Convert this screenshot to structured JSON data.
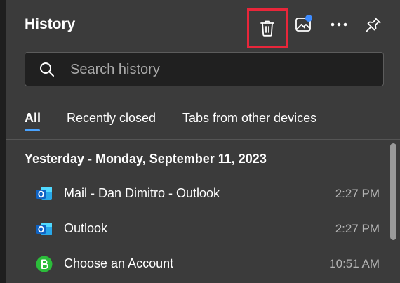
{
  "panel": {
    "title": "History",
    "buttons": {
      "delete_icon": "trash-icon",
      "open_in_page_icon": "image-frame-icon",
      "more_icon": "more-horizontal-icon",
      "pin_icon": "pin-icon"
    }
  },
  "search": {
    "placeholder": "Search history",
    "value": ""
  },
  "tabs": [
    {
      "label": "All",
      "active": true
    },
    {
      "label": "Recently closed",
      "active": false
    },
    {
      "label": "Tabs from other devices",
      "active": false
    }
  ],
  "history": {
    "day_heading": "Yesterday - Monday, September 11, 2023",
    "items": [
      {
        "title": "Mail - Dan Dimitro - Outlook",
        "time": "2:27 PM",
        "icon": "outlook-icon"
      },
      {
        "title": "Outlook",
        "time": "2:27 PM",
        "icon": "outlook-icon"
      },
      {
        "title": "Choose an Account",
        "time": "10:51 AM",
        "icon": "green-b-icon"
      }
    ]
  },
  "colors": {
    "panel_bg": "#3b3b3b",
    "accent": "#4aa3ff",
    "highlight_border": "#e8263a",
    "notification_dot": "#3d8bff"
  }
}
